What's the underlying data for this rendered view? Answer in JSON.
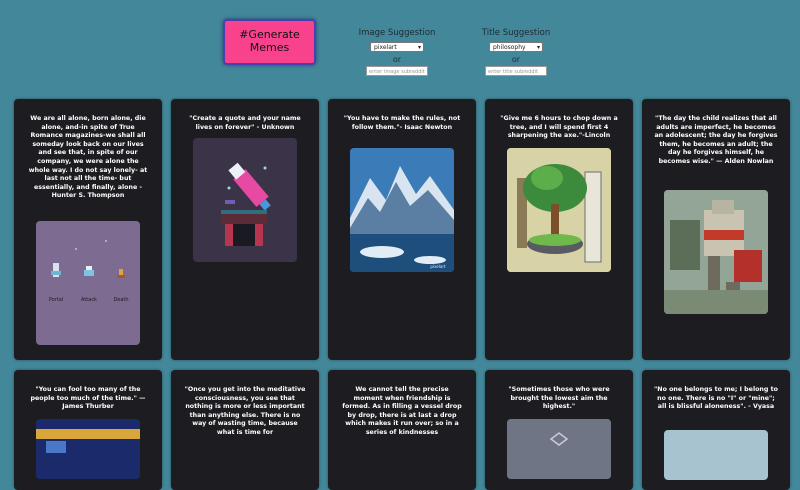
{
  "header": {
    "generate_label": "#Generate Memes",
    "image_suggestion": {
      "label": "Image Suggestion",
      "selected": "pixelart",
      "or": "or",
      "placeholder": "enter image subreddit"
    },
    "title_suggestion": {
      "label": "Title Suggestion",
      "selected": "philosophy",
      "or": "or",
      "placeholder": "enter title subreddit"
    }
  },
  "cards": [
    {
      "quote": "We are all alone, born alone, die alone, and-in spite of True Romance magazines-we shall all someday look back on our lives and see that, in spite of our company, we were alone the whole way. I do not say lonely- at last not all the time- but essentially, and finally, alone - Hunter S. Thompson",
      "image_labels": [
        "Portal",
        "Attack",
        "Death"
      ]
    },
    {
      "quote": "\"Create a quote and your name lives on forever\" - Unknown"
    },
    {
      "quote": "\"You have to make the rules, not follow them.\"- Isaac Newton",
      "image_labels": [
        "pixelart"
      ]
    },
    {
      "quote": "\"Give me 6 hours to chop down a tree, and I will spend first 4 sharpening the axe.\"-Lincoln"
    },
    {
      "quote": "\"The day the child realizes that all adults are imperfect, he becomes an adolescent; the day he forgives them, he becomes an adult; the day he forgives himself, he becomes wise.\" — Alden Nowlan"
    },
    {
      "quote": "\"You can fool too many of the people too much of the time.\" — James Thurber"
    },
    {
      "quote": "\"Once you get into the meditative consciousness, you see that nothing is more or less important than anything else. There is no way of wasting time, because what is time for"
    },
    {
      "quote": "We cannot tell the precise moment when friendship is formed. As in filling a vessel drop by drop, there is at last a drop which makes it run over; so in a series of kindnesses"
    },
    {
      "quote": "\"Sometimes those who were brought the lowest aim the highest.\""
    },
    {
      "quote": "\"No one belongs to me; I belong to no one. There is no \"I\" or \"mine\"; all is blissful aloneness\". - Vyasa"
    }
  ],
  "colors": {
    "background": "#43889a",
    "card": "#1d1c21",
    "button": "#f8428c"
  }
}
